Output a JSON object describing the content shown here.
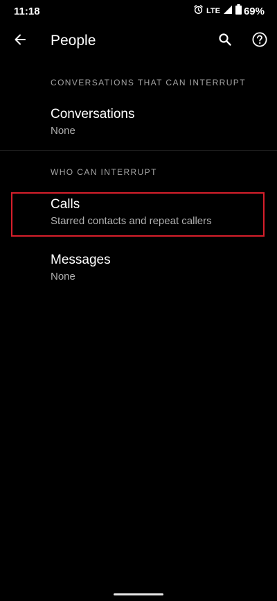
{
  "status_bar": {
    "time": "11:18",
    "network": "LTE",
    "battery_percent": "69%",
    "icons": [
      "alarm-icon",
      "signal-icon",
      "battery-icon"
    ]
  },
  "app_bar": {
    "title": "People",
    "icons": [
      "back-arrow-icon",
      "search-icon",
      "help-icon"
    ]
  },
  "sections": [
    {
      "header": "CONVERSATIONS THAT CAN INTERRUPT",
      "items": [
        {
          "title": "Conversations",
          "summary": "None"
        }
      ]
    },
    {
      "header": "WHO CAN INTERRUPT",
      "items": [
        {
          "title": "Calls",
          "summary": "Starred contacts and repeat callers",
          "highlighted": true
        },
        {
          "title": "Messages",
          "summary": "None"
        }
      ]
    }
  ],
  "colors": {
    "background": "#000000",
    "primary_text": "#ffffff",
    "secondary_text": "#b0b0b0",
    "section_header": "#a5a5a5",
    "highlight_border": "#d71f2b"
  }
}
